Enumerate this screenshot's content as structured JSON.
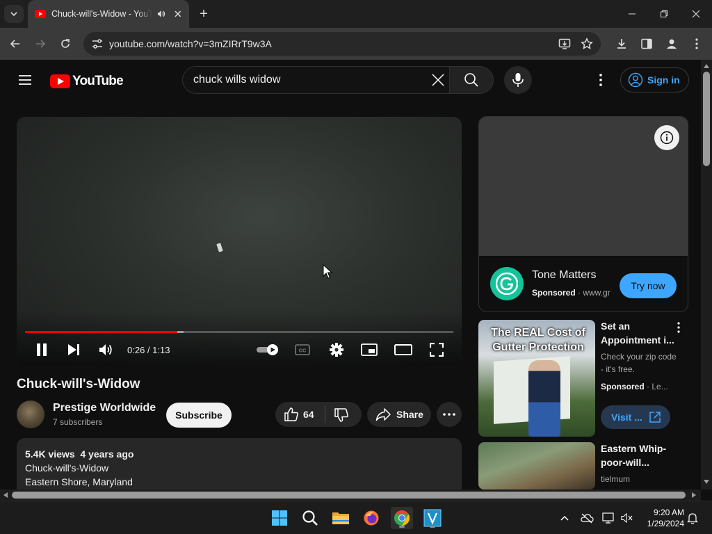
{
  "browser": {
    "tab_title": "Chuck-will's-Widow - YouTube",
    "url": "youtube.com/watch?v=3mZIRrT9w3A",
    "new_tab_glyph": "+"
  },
  "youtube": {
    "logo_text": "YouTube",
    "search_query": "chuck wills widow",
    "sign_in_label": "Sign in",
    "accent_color": "#ff0000",
    "link_color": "#3ea6ff"
  },
  "player": {
    "time_display": "0:26 / 1:13",
    "progress_fraction": 0.356,
    "buffered_fraction": 0.37
  },
  "video": {
    "title": "Chuck-will's-Widow",
    "channel_name": "Prestige Worldwide",
    "subscribers": "7 subscribers",
    "subscribe_label": "Subscribe",
    "like_count": "64",
    "share_label": "Share",
    "description": {
      "meta": "5.4K views  4 years ago",
      "line1": "Chuck-will's-Widow",
      "line2": "Eastern Shore, Maryland"
    }
  },
  "sidebar": {
    "ad": {
      "advertiser": "Tone Matters",
      "sponsored": "Sponsored",
      "domain": "www.gr",
      "cta": "Try now"
    },
    "recommendations": [
      {
        "thumbnail_text": "The REAL Cost of Gutter Protection",
        "title": "Set an Appointment i...",
        "line1": "Check your zip code - it's free.",
        "sponsored": "Sponsored",
        "advertiser": "Le...",
        "cta": "Visit ..."
      },
      {
        "title": "Eastern Whip-poor-will...",
        "channel": "tielmum"
      }
    ]
  },
  "taskbar": {
    "time": "9:20 AM",
    "date": "1/29/2024"
  }
}
